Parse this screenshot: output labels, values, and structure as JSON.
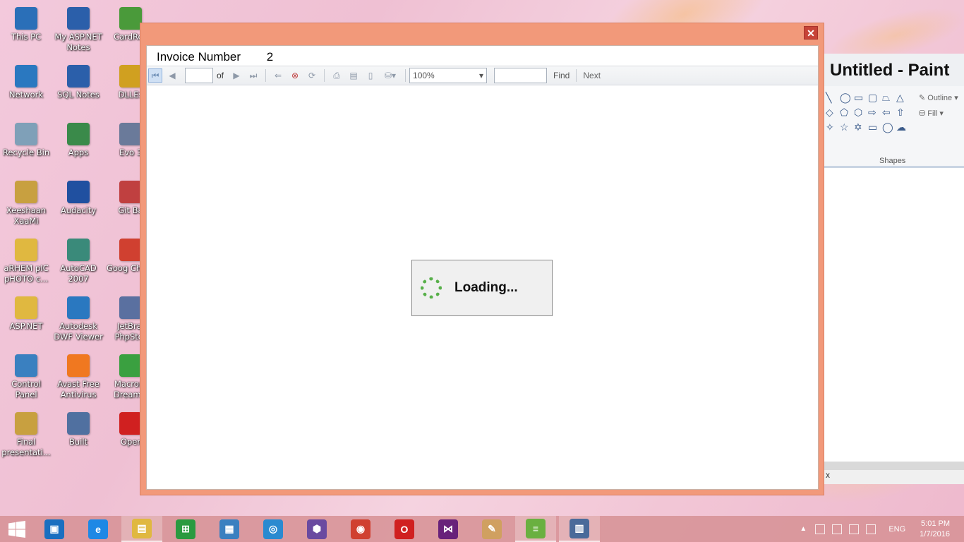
{
  "desktop": {
    "icons": [
      {
        "label": "This PC",
        "color": "#2a6fb8"
      },
      {
        "label": "My ASP.NET Notes",
        "color": "#2b5faa"
      },
      {
        "label": "CardRec",
        "color": "#4a9a3a"
      },
      {
        "label": "Network",
        "color": "#2a78c0"
      },
      {
        "label": "SQL Notes",
        "color": "#2b5faa"
      },
      {
        "label": "DLLEs",
        "color": "#d0a020"
      },
      {
        "label": "Recycle Bin",
        "color": "#7fa0b8"
      },
      {
        "label": "Apps",
        "color": "#3a8a4a"
      },
      {
        "label": "Evo 3",
        "color": "#6a7a9a"
      },
      {
        "label": "Xeeshaan XaaMi",
        "color": "#c8a040"
      },
      {
        "label": "Audacity",
        "color": "#2050a0"
      },
      {
        "label": "Git Ba",
        "color": "#c04040"
      },
      {
        "label": "aRHEM pIC pHOTO c...",
        "color": "#e0b840"
      },
      {
        "label": "AutoCAD 2007",
        "color": "#3a8a7a"
      },
      {
        "label": "Goog Chron",
        "color": "#d04030"
      },
      {
        "label": "ASP.NET",
        "color": "#e0b840"
      },
      {
        "label": "Autodesk DWF Viewer",
        "color": "#2a78c0"
      },
      {
        "label": "JetBrai PhpStor",
        "color": "#5a70a0"
      },
      {
        "label": "Control Panel",
        "color": "#3a80c0"
      },
      {
        "label": "Avast Free Antivirus",
        "color": "#f07820"
      },
      {
        "label": "Macrom Dreamw",
        "color": "#3aa040"
      },
      {
        "label": "Final presentati...",
        "color": "#c8a040"
      },
      {
        "label": "Built",
        "color": "#5070a0"
      },
      {
        "label": "Oper",
        "color": "#d02020"
      }
    ]
  },
  "window": {
    "close_icon": "✕",
    "invoice_label": "Invoice Number",
    "invoice_value": "2",
    "toolbar": {
      "page_value": "",
      "of_label": "of",
      "zoom_value": "100%",
      "find_value": "",
      "find_label": "Find",
      "next_label": "Next"
    },
    "loading_text": "Loading..."
  },
  "paint": {
    "title": "Untitled - Paint",
    "outline_label": "Outline",
    "fill_label": "Fill",
    "shapes_label": "Shapes",
    "status_text": "x"
  },
  "taskbar": {
    "apps": [
      {
        "name": "intel-graphics",
        "glyph": "▣",
        "color": "#1a6fc0"
      },
      {
        "name": "internet-explorer",
        "glyph": "e",
        "color": "#1e88e5"
      },
      {
        "name": "file-explorer",
        "glyph": "▤",
        "color": "#e0b840"
      },
      {
        "name": "store",
        "glyph": "⊞",
        "color": "#2a9a40"
      },
      {
        "name": "control-panel",
        "glyph": "▦",
        "color": "#3a80c0"
      },
      {
        "name": "app-blue",
        "glyph": "◎",
        "color": "#2a8ad0"
      },
      {
        "name": "app-hexagon",
        "glyph": "⬢",
        "color": "#6a4aa0"
      },
      {
        "name": "chrome",
        "glyph": "◉",
        "color": "#d04030"
      },
      {
        "name": "opera",
        "glyph": "O",
        "color": "#d02020"
      },
      {
        "name": "visual-studio",
        "glyph": "⋈",
        "color": "#68217a"
      },
      {
        "name": "paint",
        "glyph": "✎",
        "color": "#d0a060"
      },
      {
        "name": "bluestacks",
        "glyph": "≡",
        "color": "#6ab040"
      },
      {
        "name": "report-viewer",
        "glyph": "▥",
        "color": "#4a6a9a"
      }
    ],
    "language": "ENG",
    "time": "5:01 PM",
    "date": "1/7/2016"
  }
}
